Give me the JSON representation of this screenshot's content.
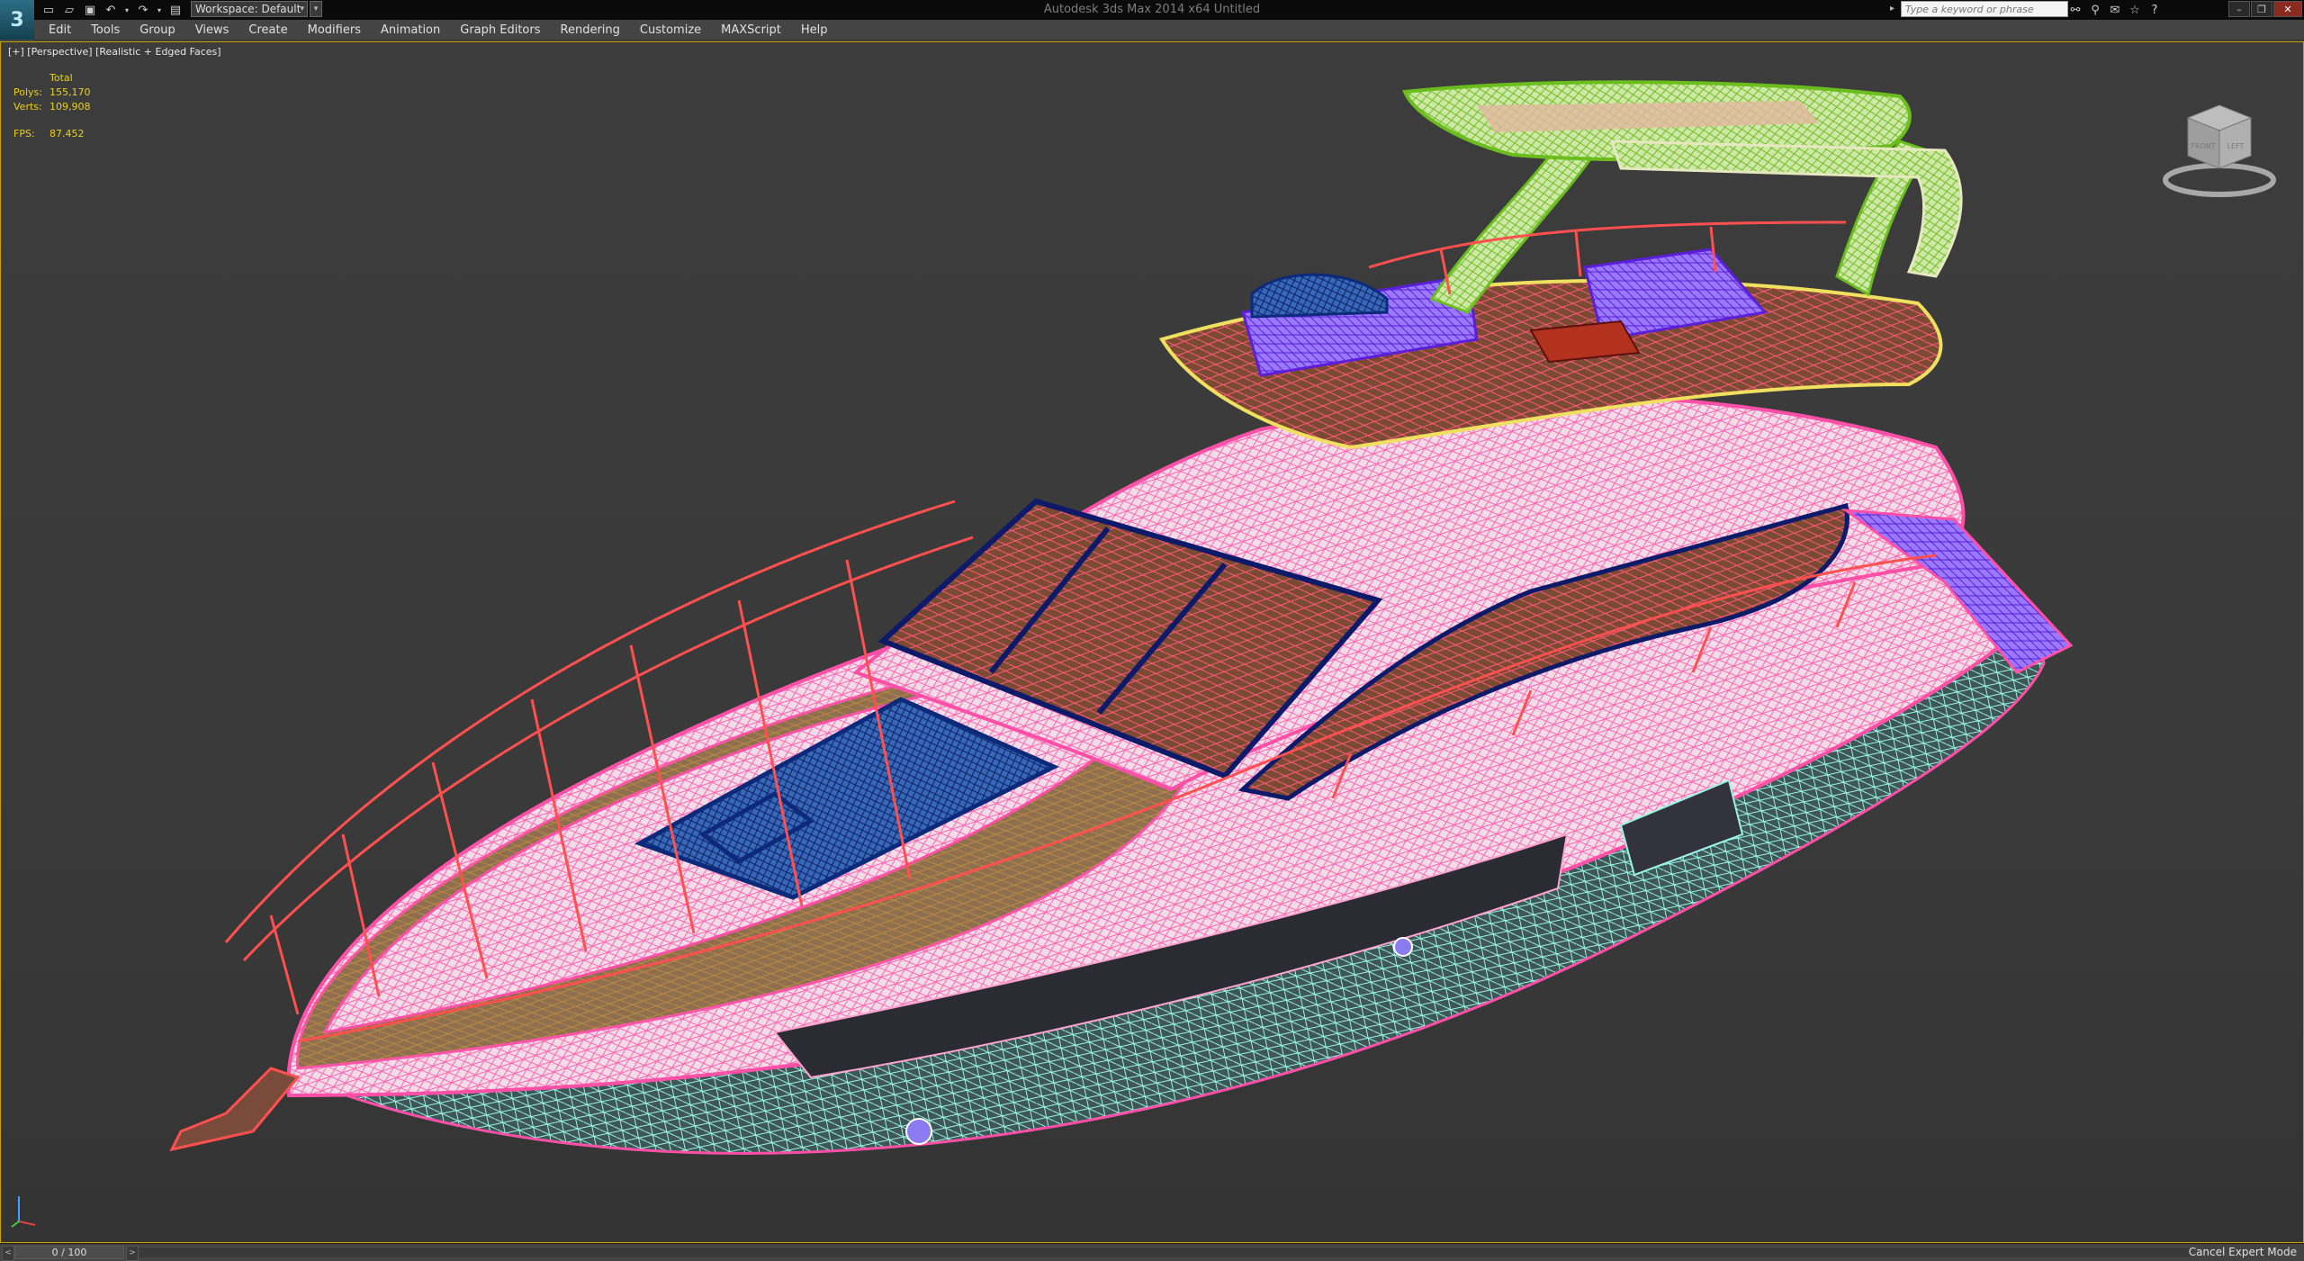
{
  "app": {
    "window_title": "Autodesk 3ds Max  2014 x64     Untitled",
    "workspace_label": "Workspace: Default",
    "search_placeholder": "Type a keyword or phrase"
  },
  "menus": [
    "Edit",
    "Tools",
    "Group",
    "Views",
    "Create",
    "Modifiers",
    "Animation",
    "Graph Editors",
    "Rendering",
    "Customize",
    "MAXScript",
    "Help"
  ],
  "viewport": {
    "label": "[+] [Perspective] [Realistic + Edged Faces]",
    "stats": {
      "header": "Total",
      "polys_label": "Polys:",
      "polys_value": "155,170",
      "verts_label": "Verts:",
      "verts_value": "109,908",
      "fps_label": "FPS:",
      "fps_value": "87.452"
    },
    "viewcube": {
      "face_front": "FRONT",
      "face_left": "LEFT"
    }
  },
  "timeline": {
    "frame_display": "0 / 100"
  },
  "status": {
    "cancel_expert_mode": "Cancel Expert Mode"
  },
  "colors": {
    "viewport_border": "#c8a000",
    "stats_text": "#e8d020",
    "hull_pink": "#ff6fb7",
    "hull_cyan": "#9af5e6",
    "railing_red": "#ff5050",
    "hardtop_green": "#8ed23a",
    "cushion_purple": "#7a3cff",
    "hatch_blue": "#2a63c4"
  },
  "icons": {
    "app_logo": "3ds-max-logo-icon",
    "quick_access": [
      "new-file-icon",
      "open-file-icon",
      "save-icon",
      "undo-icon",
      "undo-dropdown-icon",
      "redo-icon",
      "redo-dropdown-icon",
      "hold-icon"
    ],
    "toolbar_right": [
      "binoculars-icon",
      "search-tools-icon",
      "communication-center-icon",
      "favorites-icon",
      "help-icon"
    ]
  }
}
